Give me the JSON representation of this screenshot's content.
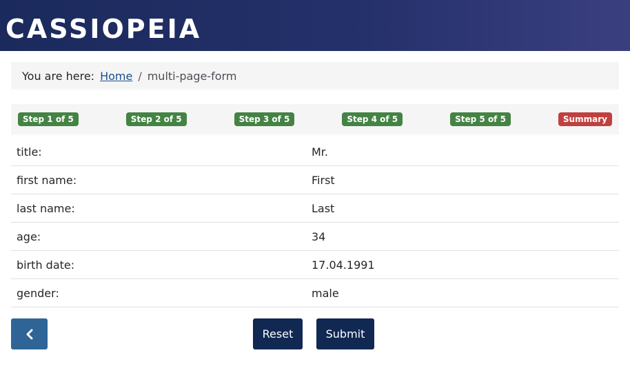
{
  "header": {
    "brand": "CASSIOPEIA"
  },
  "breadcrumb": {
    "prefix": "You are here:",
    "home": "Home",
    "separator": "/",
    "current": "multi-page-form"
  },
  "steps": [
    {
      "label": "Step 1 of 5",
      "status": "done"
    },
    {
      "label": "Step 2 of 5",
      "status": "done"
    },
    {
      "label": "Step 3 of 5",
      "status": "done"
    },
    {
      "label": "Step 4 of 5",
      "status": "done"
    },
    {
      "label": "Step 5 of 5",
      "status": "done"
    },
    {
      "label": "Summary",
      "status": "current"
    }
  ],
  "summary": [
    {
      "label": "title:",
      "value": "Mr."
    },
    {
      "label": "first name:",
      "value": "First"
    },
    {
      "label": "last name:",
      "value": "Last"
    },
    {
      "label": "age:",
      "value": "34"
    },
    {
      "label": "birth date:",
      "value": "17.04.1991"
    },
    {
      "label": "gender:",
      "value": "male"
    }
  ],
  "buttons": {
    "back_icon": "chevron-left-icon",
    "reset": "Reset",
    "submit": "Submit"
  },
  "colors": {
    "header": "#1b2a5c",
    "done": "#448344",
    "current": "#c04040",
    "primary": "#112853",
    "back": "#2f6496"
  }
}
